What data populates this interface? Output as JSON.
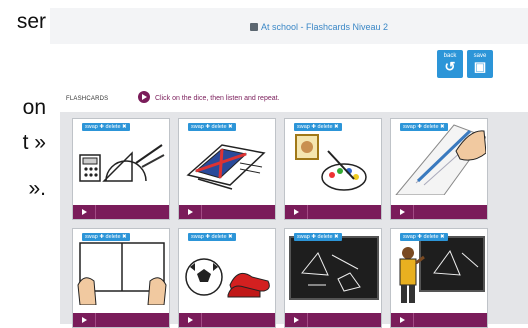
{
  "side_text": [
    "ser",
    "on",
    "t »",
    "»."
  ],
  "header": {
    "title": "At school - Flashcards Niveau 2"
  },
  "toolbar": {
    "back_label": "back",
    "back_symbol": "↺",
    "save_label": "save",
    "save_symbol": "▣"
  },
  "flashcards": {
    "heading": "FLASHCARDS",
    "instruction": "Click on the dice, then listen and repeat.",
    "cards": [
      {
        "swap": "swap ✚",
        "delete": "delete ✖",
        "icon": "school-tools-icon"
      },
      {
        "swap": "swap ✚",
        "delete": "delete ✖",
        "icon": "books-icon"
      },
      {
        "swap": "swap ✚",
        "delete": "delete ✖",
        "icon": "paint-palette-icon"
      },
      {
        "swap": "swap ✚",
        "delete": "delete ✖",
        "icon": "writing-hand-icon"
      },
      {
        "swap": "swap ✚",
        "delete": "delete ✖",
        "icon": "open-book-icon"
      },
      {
        "swap": "swap ✚",
        "delete": "delete ✖",
        "icon": "ball-shoes-icon"
      },
      {
        "swap": "swap ✚",
        "delete": "delete ✖",
        "icon": "blackboard-icon"
      },
      {
        "swap": "swap ✚",
        "delete": "delete ✖",
        "icon": "teacher-board-icon"
      }
    ]
  },
  "colors": {
    "accent_blue": "#2c95d8",
    "card_purple": "#7a1c5a"
  }
}
